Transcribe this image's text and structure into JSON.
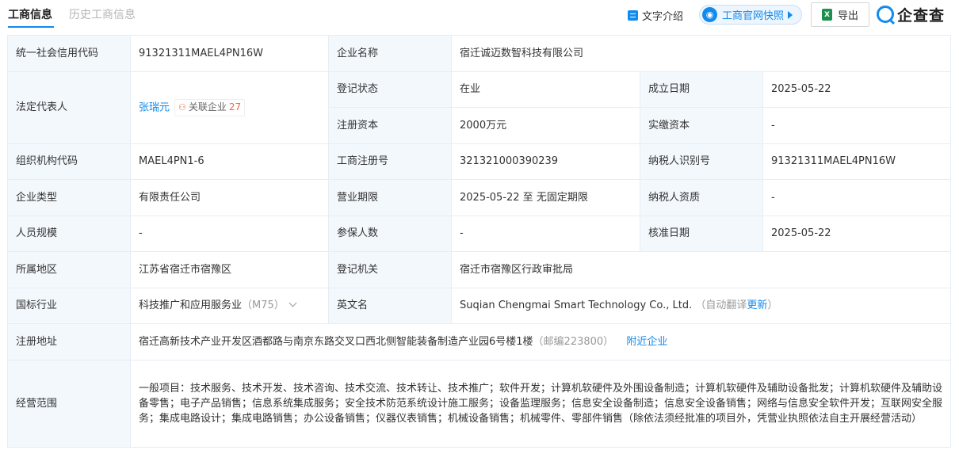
{
  "tabs": {
    "active": "工商信息",
    "history": "历史工商信息"
  },
  "toolbar": {
    "text_intro": "文字介绍",
    "snapshot": "工商官网快照",
    "export": "导出",
    "export_icon_letter": "X",
    "logo_text": "企查查"
  },
  "labels": {
    "credit_code": "统一社会信用代码",
    "company_name": "企业名称",
    "legal_rep": "法定代表人",
    "reg_status": "登记状态",
    "found_date": "成立日期",
    "reg_capital": "注册资本",
    "paid_capital": "实缴资本",
    "org_code": "组织机构代码",
    "reg_no": "工商注册号",
    "taxpayer_id": "纳税人识别号",
    "company_type": "企业类型",
    "business_term": "营业期限",
    "taxpayer_qual": "纳税人资质",
    "staff_size": "人员规模",
    "insured": "参保人数",
    "approval_date": "核准日期",
    "region": "所属地区",
    "reg_authority": "登记机关",
    "industry": "国标行业",
    "english_name": "英文名",
    "reg_address": "注册地址",
    "business_scope": "经营范围"
  },
  "values": {
    "credit_code": "91321311MAEL4PN16W",
    "company_name": "宿迁诚迈数智科技有限公司",
    "legal_rep_name": "张瑞元",
    "related_label": "关联企业",
    "related_count": "27",
    "reg_status": "在业",
    "found_date": "2025-05-22",
    "reg_capital": "2000万元",
    "paid_capital": "-",
    "org_code": "MAEL4PN1-6",
    "reg_no": "321321000390239",
    "taxpayer_id": "91321311MAEL4PN16W",
    "company_type": "有限责任公司",
    "business_term": "2025-05-22 至 无固定期限",
    "taxpayer_qual": "-",
    "staff_size": "-",
    "insured": "-",
    "approval_date": "2025-05-22",
    "region": "江苏省宿迁市宿豫区",
    "reg_authority": "宿迁市宿豫区行政审批局",
    "industry": "科技推广和应用服务业",
    "industry_code": "（M75）",
    "english_name": "Suqian Chengmai Smart Technology Co., Ltd.",
    "auto_translate": "（自动翻译",
    "update_link": "更新",
    "auto_translate_close": "）",
    "reg_address": "宿迁高新技术产业开发区酒都路与南京东路交叉口西北侧智能装备制造产业园6号楼1楼",
    "postcode": "（邮编223800）",
    "nearby": "附近企业",
    "business_scope": "一般项目：技术服务、技术开发、技术咨询、技术交流、技术转让、技术推广；软件开发；计算机软硬件及外围设备制造；计算机软硬件及辅助设备批发；计算机软硬件及辅助设备零售；电子产品销售；信息系统集成服务；安全技术防范系统设计施工服务；设备监理服务；信息安全设备制造；信息安全设备销售；网络与信息安全软件开发；互联网安全服务；集成电路设计；集成电路销售；办公设备销售；仪器仪表销售；机械设备销售；机械零件、零部件销售（除依法须经批准的项目外，凭营业执照依法自主开展经营活动）"
  },
  "colors": {
    "accent": "#128bed",
    "label_bg": "#f3f8fd",
    "border": "#e6edf5",
    "related_orange": "#f06a3d"
  }
}
